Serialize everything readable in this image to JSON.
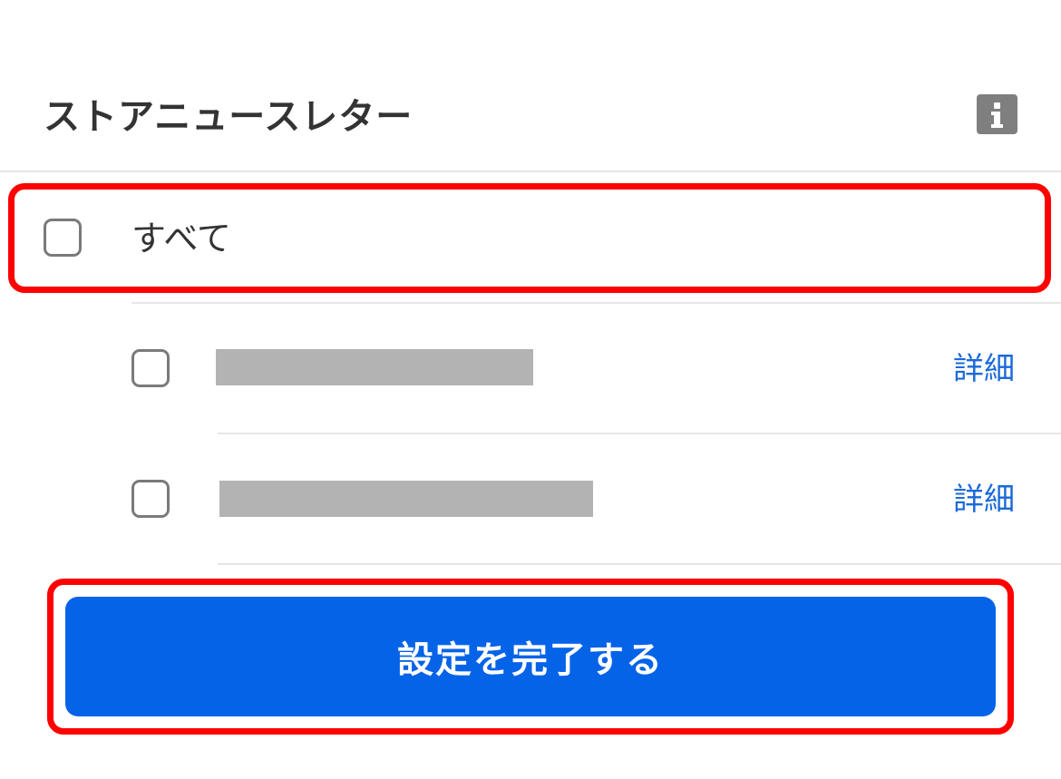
{
  "header": {
    "title": "ストアニュースレター",
    "info_icon": "info-icon"
  },
  "options": {
    "all": {
      "label": "すべて",
      "checked": false
    },
    "items": [
      {
        "label_redacted": true,
        "checked": false,
        "detail_label": "詳細"
      },
      {
        "label_redacted": true,
        "checked": false,
        "detail_label": "詳細"
      }
    ]
  },
  "footer": {
    "submit_label": "設定を完了する"
  },
  "colors": {
    "accent": "#0563e8",
    "link": "#1a6ad8",
    "highlight": "#ff0000",
    "info_icon_bg": "#7f7f7f"
  }
}
